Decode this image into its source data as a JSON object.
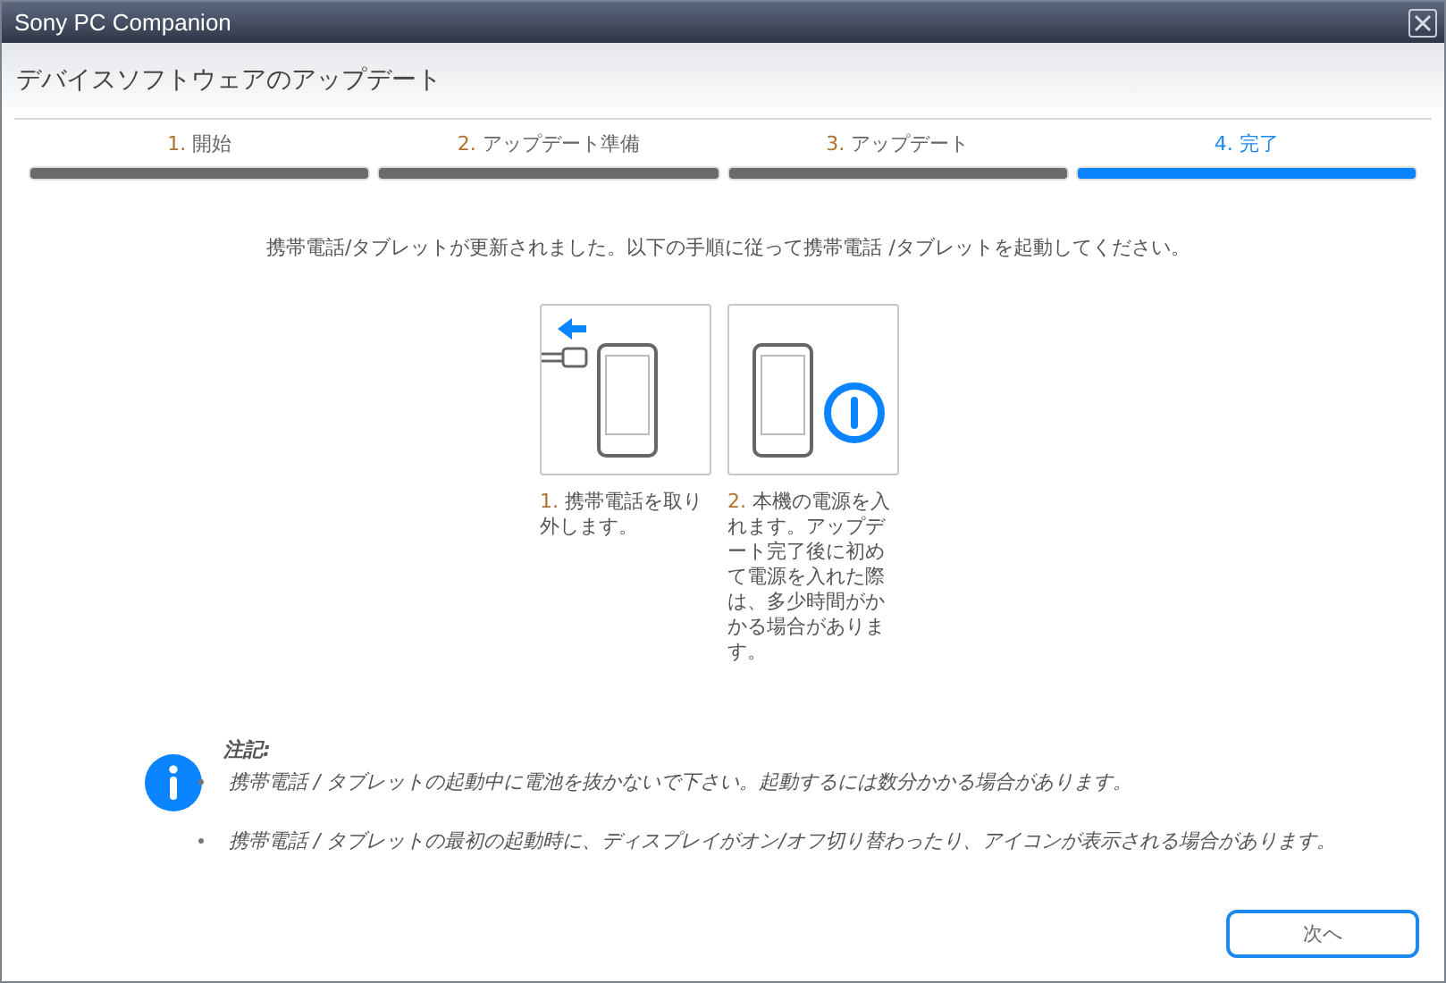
{
  "window": {
    "title": "Sony PC Companion"
  },
  "header": {
    "title": "デバイスソフトウェアのアップデート"
  },
  "steps": [
    {
      "number": "1.",
      "label": "開始",
      "selected": false
    },
    {
      "number": "2.",
      "label": "アップデート準備",
      "selected": false
    },
    {
      "number": "3.",
      "label": "アップデート",
      "selected": false
    },
    {
      "number": "4.",
      "label": "完了",
      "selected": true
    }
  ],
  "instruction": "携帯電話/タブレットが更新されました。以下の手順に従って携帯電話 /タブレットを起動してください。",
  "cards": [
    {
      "kind": "unplug",
      "number": "1.",
      "caption": "携帯電話を取り外します。"
    },
    {
      "kind": "power",
      "number": "2.",
      "caption": "本機の電源を入れます。アップデート完了後に初めて電源を入れた際は、多少時間がかかる場合があります。"
    }
  ],
  "note": {
    "title": "注記:",
    "items": [
      "携帯電話 / タブレットの起動中に電池を抜かないで下さい。起動するには数分かかる場合があります。",
      "携帯電話 / タブレットの最初の起動時に、ディスプレイがオン/オフ切り替わったり、アイコンが表示される場合があります。"
    ]
  },
  "buttons": [
    "次へ"
  ]
}
